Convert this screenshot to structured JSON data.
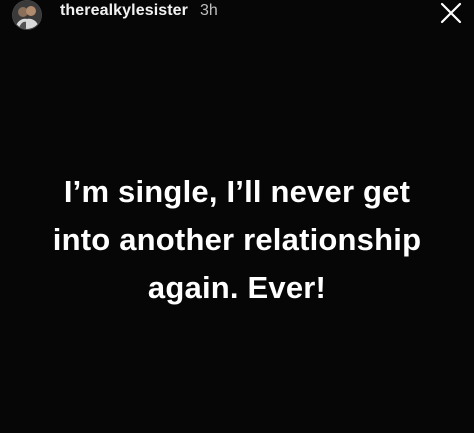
{
  "story": {
    "username": "therealkylesister",
    "time": "3h",
    "avatar_icon": "profile-photo",
    "close_icon": "close-x-icon",
    "message_lines": [
      "I’m single, I’ll never get",
      "into another relationship",
      "again. Ever!"
    ],
    "background_color": "#060606",
    "text_color": "#ffffff"
  }
}
